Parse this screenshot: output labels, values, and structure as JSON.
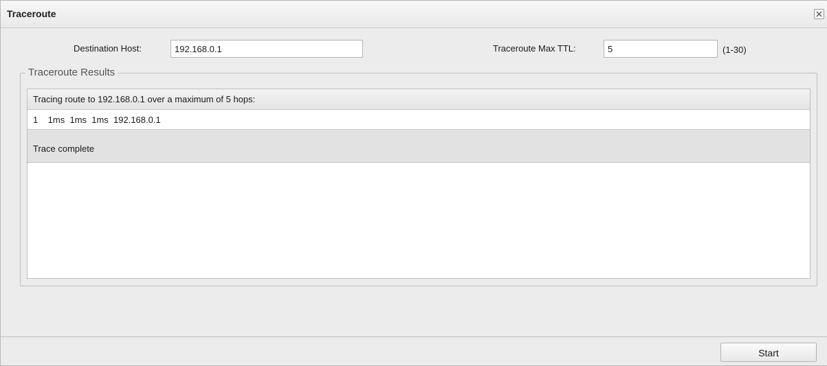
{
  "dialog": {
    "title": "Traceroute",
    "close_icon": "close-icon"
  },
  "form": {
    "destination_label": "Destination Host:",
    "destination_value": "192.168.0.1",
    "ttl_label": "Traceroute Max TTL:",
    "ttl_value": "5",
    "ttl_range_hint": "(1-30)"
  },
  "results": {
    "legend": "Traceroute Results",
    "lines": [
      "Tracing route to 192.168.0.1 over a maximum of 5 hops:",
      "1    1ms  1ms  1ms  192.168.0.1",
      "Trace complete"
    ]
  },
  "footer": {
    "start_label": "Start"
  },
  "colors": {
    "window_bg": "#ececec",
    "panel_bg": "#ffffff",
    "complete_row_bg": "#e2e2e2",
    "border": "#b5b5b5"
  }
}
